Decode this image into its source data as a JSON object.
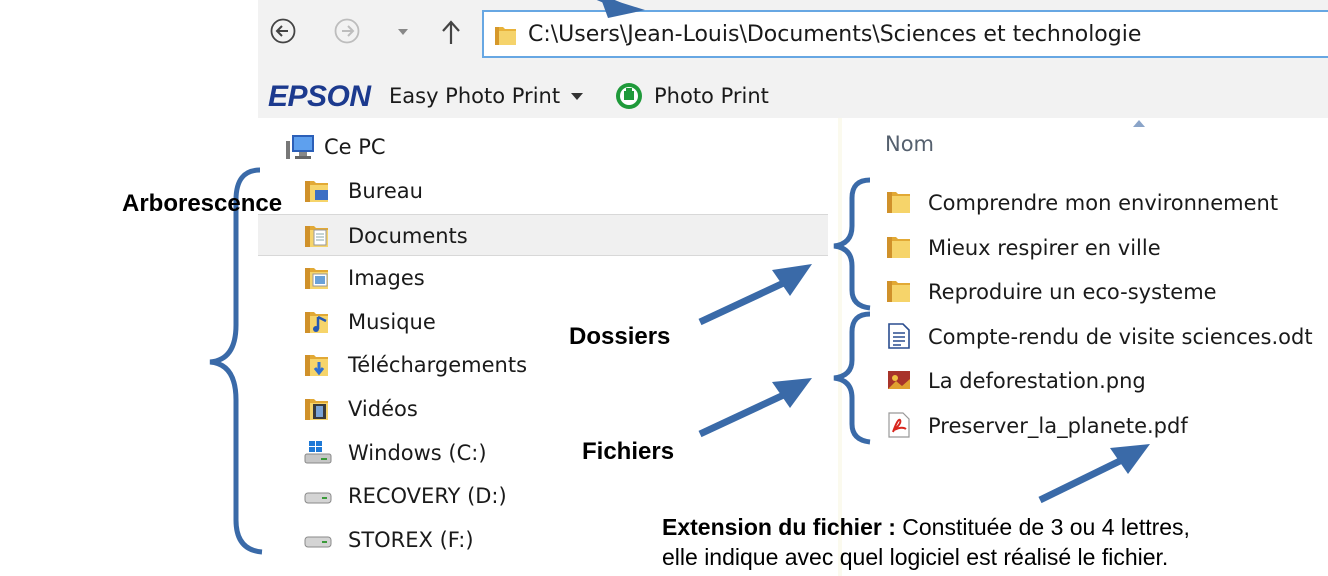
{
  "address_bar": {
    "path": "C:\\Users\\Jean-Louis\\Documents\\Sciences et technologie"
  },
  "toolbar": {
    "brand": "EPSON",
    "easy_photo_print": "Easy Photo Print",
    "photo_print": "Photo Print"
  },
  "tree": {
    "root": "Ce PC",
    "items": [
      {
        "label": "Bureau",
        "icon": "desktop-folder-icon"
      },
      {
        "label": "Documents",
        "icon": "documents-folder-icon",
        "selected": true
      },
      {
        "label": "Images",
        "icon": "pictures-folder-icon"
      },
      {
        "label": "Musique",
        "icon": "music-folder-icon"
      },
      {
        "label": "Téléchargements",
        "icon": "downloads-folder-icon"
      },
      {
        "label": "Vidéos",
        "icon": "videos-folder-icon"
      },
      {
        "label": "Windows (C:)",
        "icon": "windows-drive-icon"
      },
      {
        "label": "RECOVERY (D:)",
        "icon": "drive-icon"
      },
      {
        "label": "STOREX (F:)",
        "icon": "drive-icon"
      }
    ]
  },
  "files": {
    "column_header": "Nom",
    "folders": [
      "Comprendre mon environnement",
      "Mieux respirer en ville",
      "Reproduire un eco-systeme"
    ],
    "documents": [
      {
        "name": "Compte-rendu de visite sciences.odt",
        "icon": "odt-file-icon"
      },
      {
        "name": "La deforestation.png",
        "icon": "png-file-icon"
      },
      {
        "name": "Preserver_la_planete.pdf",
        "icon": "pdf-file-icon"
      }
    ]
  },
  "annotations": {
    "arborescence": "Arborescence",
    "dossiers": "Dossiers",
    "fichiers": "Fichiers",
    "extension_title": "Extension du fichier :",
    "extension_line1": " Constituée de 3 ou 4 lettres,",
    "extension_line2": "elle indique avec quel logiciel est réalisé le fichier."
  },
  "colors": {
    "arrow": "#3a6aa8",
    "selection": "#f0f0f0",
    "address_border": "#67a7e3",
    "epson": "#1c3a8e"
  }
}
